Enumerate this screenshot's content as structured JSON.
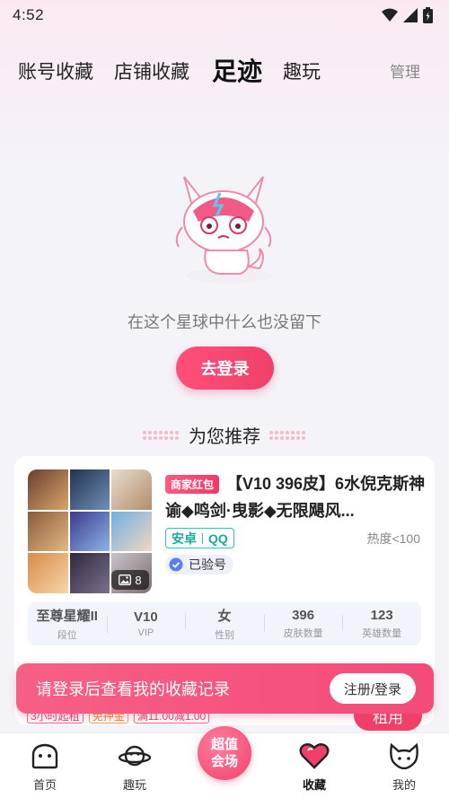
{
  "status_bar": {
    "time": "4:52"
  },
  "tabs": {
    "items": [
      "账号收藏",
      "店铺收藏",
      "足迹",
      "趣玩"
    ],
    "active": "足迹",
    "manage": "管理"
  },
  "empty_state": {
    "message": "在这个星球中什么也没留下",
    "button": "去登录"
  },
  "recommend": {
    "title": "为您推荐",
    "card": {
      "badge": "商家红包",
      "title": "【V10 396皮】6水倪克斯神谕◆鸣剑·曳影◆无限飓风...",
      "platform": "安卓",
      "account_type": "QQ",
      "heat": "热度<100",
      "verified": "已验号",
      "image_count": "8",
      "stats": [
        {
          "value": "至尊星耀II",
          "label": "段位"
        },
        {
          "value": "V10",
          "label": "VIP"
        },
        {
          "value": "女",
          "label": "性别"
        },
        {
          "value": "396",
          "label": "皮肤数量"
        },
        {
          "value": "123",
          "label": "英雄数量"
        }
      ],
      "tags": [
        "3小时起租",
        "免押金",
        "满11.00减1.00"
      ],
      "rent_button": "租用"
    }
  },
  "login_banner": {
    "message": "请登录后查看我的收藏记录",
    "button": "注册/登录"
  },
  "bottom_nav": {
    "items": [
      "首页",
      "趣玩",
      "收藏",
      "我的"
    ],
    "center_label_1": "超值",
    "center_label_2": "会场",
    "active": "收藏"
  },
  "colors": {
    "accent": "#f0406a",
    "teal": "#2bc7bf"
  }
}
